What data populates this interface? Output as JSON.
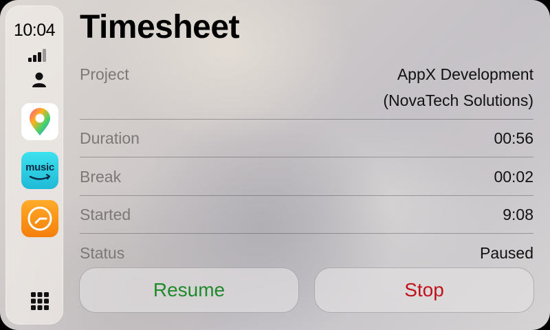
{
  "status_bar": {
    "time": "10:04"
  },
  "dock": {
    "apps": [
      {
        "name": "maps",
        "icon": "maps-pin-icon"
      },
      {
        "name": "music",
        "label": "music",
        "icon": "amazon-music-icon"
      },
      {
        "name": "clock",
        "icon": "clock-icon"
      }
    ]
  },
  "page": {
    "title": "Timesheet",
    "rows": [
      {
        "label": "Project",
        "value_line1": "AppX Development",
        "value_line2": "(NovaTech Solutions)"
      },
      {
        "label": "Duration",
        "value": "00:56"
      },
      {
        "label": "Break",
        "value": "00:02"
      },
      {
        "label": "Started",
        "value": "9:08"
      },
      {
        "label": "Status",
        "value": "Paused"
      }
    ]
  },
  "actions": {
    "resume_label": "Resume",
    "stop_label": "Stop",
    "resume_color": "#1f8a2a",
    "stop_color": "#c1121c"
  }
}
